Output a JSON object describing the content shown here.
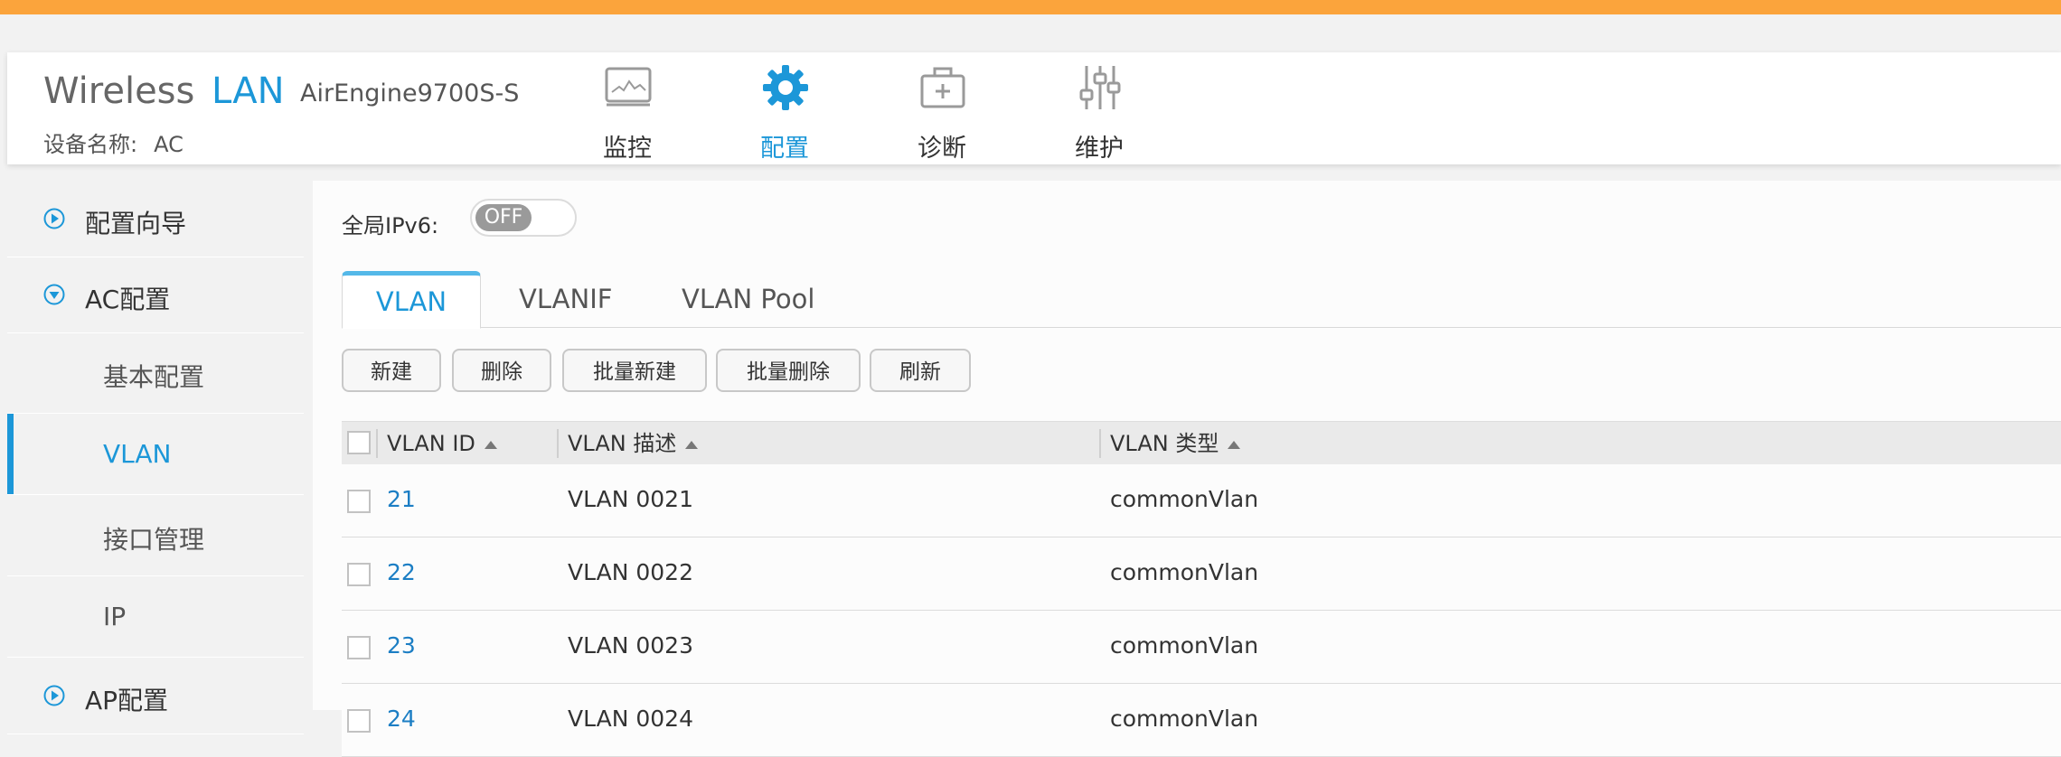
{
  "header": {
    "brand_wireless": "Wireless",
    "brand_lan": "LAN",
    "model": "AirEngine9700S-S",
    "device_label": "设备名称:",
    "device_value": "AC",
    "nav": [
      {
        "label": "监控",
        "icon": "monitor-icon"
      },
      {
        "label": "配置",
        "icon": "gear-icon",
        "active": true
      },
      {
        "label": "诊断",
        "icon": "medkit-icon"
      },
      {
        "label": "维护",
        "icon": "sliders-icon"
      }
    ]
  },
  "sidebar": {
    "items": [
      {
        "label": "配置向导",
        "state": "collapsed"
      },
      {
        "label": "AC配置",
        "state": "expanded"
      },
      {
        "label": "基本配置"
      },
      {
        "label": "VLAN",
        "active": true
      },
      {
        "label": "接口管理"
      },
      {
        "label": "IP"
      },
      {
        "label": "AP配置",
        "state": "collapsed"
      }
    ]
  },
  "main": {
    "ipv6_label": "全局IPv6:",
    "ipv6_toggle": "OFF",
    "tabs": [
      "VLAN",
      "VLANIF",
      "VLAN Pool"
    ],
    "active_tab": "VLAN",
    "buttons": [
      "新建",
      "删除",
      "批量新建",
      "批量删除",
      "刷新"
    ],
    "table": {
      "columns": [
        "VLAN ID",
        "VLAN 描述",
        "VLAN 类型"
      ],
      "rows": [
        {
          "id": "21",
          "desc": "VLAN 0021",
          "type": "commonVlan"
        },
        {
          "id": "22",
          "desc": "VLAN 0022",
          "type": "commonVlan"
        },
        {
          "id": "23",
          "desc": "VLAN 0023",
          "type": "commonVlan"
        },
        {
          "id": "24",
          "desc": "VLAN 0024",
          "type": "commonVlan"
        }
      ]
    }
  },
  "colors": {
    "accent": "#1c97d8",
    "topbar": "#fba43c"
  }
}
